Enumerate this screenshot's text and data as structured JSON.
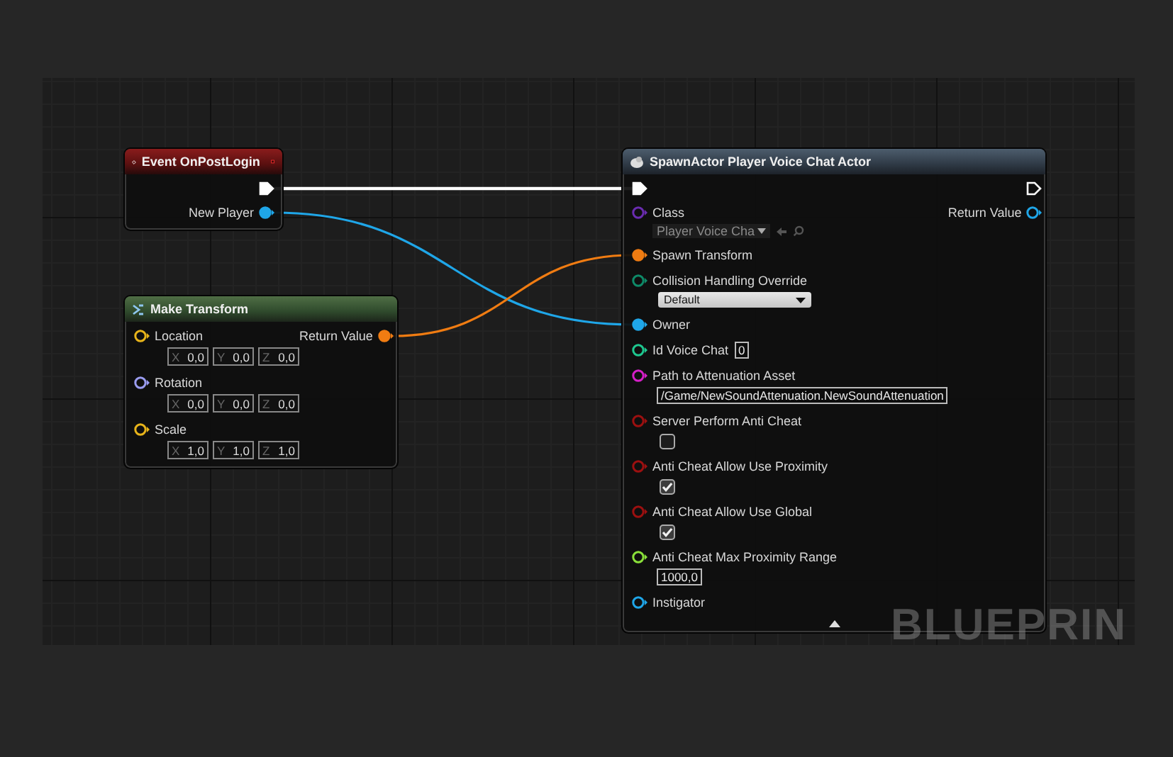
{
  "graph": {
    "corner_label": "BLUEPRIN",
    "nodes": [
      {
        "kind": "event",
        "title": "Event OnPostLogin",
        "outputs": [
          {
            "kind": "exec",
            "connected": true
          },
          {
            "kind": "data",
            "label": "New Player",
            "color": "#1fa6e8",
            "connected": true
          }
        ]
      },
      {
        "kind": "function",
        "title": "Make Transform",
        "inputs": [
          {
            "kind": "data",
            "label": "Location",
            "color": "#e8b41a",
            "connected": false,
            "widget": {
              "kind": "vector",
              "fields": [
                {
                  "axis": "X",
                  "value": "0,0"
                },
                {
                  "axis": "Y",
                  "value": "0,0"
                },
                {
                  "axis": "Z",
                  "value": "0,0"
                }
              ]
            }
          },
          {
            "kind": "data",
            "label": "Rotation",
            "color": "#9a9cf0",
            "connected": false,
            "widget": {
              "kind": "vector",
              "fields": [
                {
                  "axis": "X",
                  "value": "0,0"
                },
                {
                  "axis": "Y",
                  "value": "0,0"
                },
                {
                  "axis": "Z",
                  "value": "0,0"
                }
              ]
            }
          },
          {
            "kind": "data",
            "label": "Scale",
            "color": "#e8b41a",
            "connected": false,
            "widget": {
              "kind": "vector",
              "fields": [
                {
                  "axis": "X",
                  "value": "1,0"
                },
                {
                  "axis": "Y",
                  "value": "1,0"
                },
                {
                  "axis": "Z",
                  "value": "1,0"
                }
              ]
            }
          }
        ],
        "outputs": [
          {
            "kind": "data",
            "label": "Return Value",
            "color": "#f07c12",
            "connected": true
          }
        ]
      },
      {
        "kind": "spawn",
        "title": "SpawnActor Player Voice Chat Actor",
        "inputs": [
          {
            "kind": "exec",
            "connected": true
          },
          {
            "kind": "data",
            "label": "Class",
            "color": "#6a2cb0",
            "connected": false,
            "widget": {
              "kind": "class",
              "value": "Player Voice Cha"
            }
          },
          {
            "kind": "data",
            "label": "Spawn Transform",
            "color": "#f07c12",
            "connected": true
          },
          {
            "kind": "data",
            "label": "Collision Handling Override",
            "color": "#0e8a68",
            "connected": false,
            "widget": {
              "kind": "dropdown",
              "value": "Default"
            }
          },
          {
            "kind": "data",
            "label": "Owner",
            "color": "#1fa6e8",
            "connected": true
          },
          {
            "kind": "data",
            "label": "Id Voice Chat",
            "color": "#1ec890",
            "connected": false,
            "widget": {
              "kind": "number",
              "inline": true,
              "value": "0"
            }
          },
          {
            "kind": "data",
            "label": "Path to Attenuation Asset",
            "color": "#d61fc8",
            "connected": false,
            "widget": {
              "kind": "text",
              "value": "/Game/NewSoundAttenuation.NewSoundAttenuation"
            }
          },
          {
            "kind": "data",
            "label": "Server Perform Anti Cheat",
            "color": "#9c1010",
            "connected": false,
            "widget": {
              "kind": "checkbox",
              "checked": false
            }
          },
          {
            "kind": "data",
            "label": "Anti Cheat Allow Use Proximity",
            "color": "#9c1010",
            "connected": false,
            "widget": {
              "kind": "checkbox",
              "checked": true
            }
          },
          {
            "kind": "data",
            "label": "Anti Cheat Allow Use Global",
            "color": "#9c1010",
            "connected": false,
            "widget": {
              "kind": "checkbox",
              "checked": true
            }
          },
          {
            "kind": "data",
            "label": "Anti Cheat Max Proximity Range",
            "color": "#8ae03a",
            "connected": false,
            "widget": {
              "kind": "number",
              "inline": false,
              "value": "1000,0"
            }
          },
          {
            "kind": "data",
            "label": "Instigator",
            "color": "#1fa6e8",
            "connected": false
          }
        ],
        "outputs": [
          {
            "kind": "exec",
            "connected": false
          },
          {
            "kind": "data",
            "label": "Return Value",
            "color": "#1fa6e8",
            "connected": false
          }
        ]
      }
    ]
  }
}
